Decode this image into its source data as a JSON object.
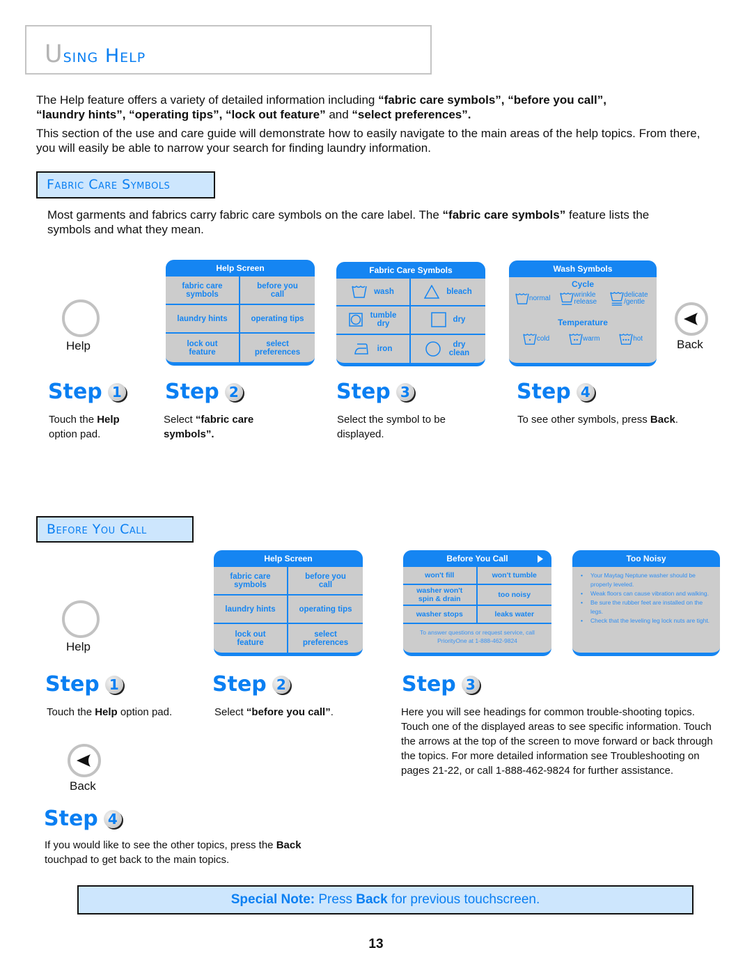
{
  "page": {
    "title_first": "U",
    "title_rest": "sing",
    "title_second": "Help",
    "intro_1_a": "The Help feature offers a variety of detailed information including ",
    "intro_1_b": "“fabric care symbols”, “before you call”,",
    "intro_1_c": "“laundry hints”, “operating tips”, “lock out feature”",
    "intro_1_d": " and ",
    "intro_1_e": "“select preferences”.",
    "intro_2": "This section of the use and care guide will demonstrate how to easily navigate to the main areas of the help topics. From there, you will easily be able to narrow your search for finding laundry information.",
    "page_number": "13"
  },
  "fabric_care": {
    "heading": "Fabric Care Symbols",
    "desc_a": "Most garments and fabrics carry fabric care symbols on the care label. The ",
    "desc_b": "“fabric care symbols”",
    "desc_c": " feature lists the symbols and what they mean.",
    "help_pad_label": "Help",
    "back_pad_label": "Back",
    "help_screen": {
      "title": "Help Screen",
      "items": [
        "fabric care symbols",
        "before you call",
        "laundry hints",
        "operating tips",
        "lock out feature",
        "select preferences"
      ]
    },
    "symbols_screen": {
      "title": "Fabric Care Symbols",
      "items": [
        "wash",
        "bleach",
        "tumble dry",
        "dry",
        "iron",
        "dry clean"
      ]
    },
    "wash_screen": {
      "title": "Wash Symbols",
      "cycle_heading": "Cycle",
      "cycle": [
        "normal",
        "wrinkle release",
        "delicate /gentle"
      ],
      "temp_heading": "Temperature",
      "temps": [
        "cold",
        "warm",
        "hot"
      ]
    },
    "steps": [
      {
        "label": "Step",
        "num": "1",
        "desc_a": "Touch the ",
        "desc_b": "Help",
        "desc_c": " option pad."
      },
      {
        "label": "Step",
        "num": "2",
        "desc_a": "Select ",
        "desc_b": "“fabric care symbols”.",
        "desc_c": ""
      },
      {
        "label": "Step",
        "num": "3",
        "desc_a": "Select the symbol to be displayed.",
        "desc_b": "",
        "desc_c": ""
      },
      {
        "label": "Step",
        "num": "4",
        "desc_a": "To see other symbols, press ",
        "desc_b": "Back",
        "desc_c": "."
      }
    ]
  },
  "before_call": {
    "heading": "Before You Call",
    "help_pad_label": "Help",
    "back_pad_label": "Back",
    "help_screen": {
      "title": "Help Screen",
      "items": [
        "fabric care symbols",
        "before you call",
        "laundry hints",
        "operating tips",
        "lock out feature",
        "select preferences"
      ]
    },
    "byc_screen": {
      "title": "Before You Call",
      "items": [
        "won't fill",
        "won't tumble",
        "washer won't spin & drain",
        "too noisy",
        "washer stops",
        "leaks water"
      ],
      "footer": "To answer questions or request service, call PriorityOne at 1-888-462-9824"
    },
    "noisy_screen": {
      "title": "Too Noisy",
      "bullets": [
        "Your Maytag Neptune washer should be properly leveled.",
        "Weak floors can cause vibration and walking.",
        "Be sure the rubber feet are installed on the legs.",
        "Check that the leveling leg lock nuts are tight."
      ]
    },
    "steps": [
      {
        "label": "Step",
        "num": "1",
        "desc_a": "Touch the ",
        "desc_b": "Help",
        "desc_c": " option pad."
      },
      {
        "label": "Step",
        "num": "2",
        "desc_a": "Select ",
        "desc_b": "“before you call”",
        "desc_c": "."
      },
      {
        "label": "Step",
        "num": "3",
        "desc_a": "Here you will see headings for common trouble-shooting topics. Touch one of the displayed areas to see specific information. Touch the arrows at the top of the screen to move forward or back through the topics.  For more detailed information see Troubleshooting on pages 21-22, or call 1-888-462-9824 for further assistance.",
        "desc_b": "",
        "desc_c": ""
      },
      {
        "label": "Step",
        "num": "4",
        "desc_a": "If you would like to see the other topics, press the ",
        "desc_b": "Back",
        "desc_c": " touchpad to get back to the main topics."
      }
    ]
  },
  "special_note": {
    "label": "Special Note:",
    "text_a": " Press ",
    "text_b": "Back",
    "text_c": " for previous touchscreen."
  },
  "colors": {
    "accent_blue": "#0a7ff2",
    "screen_blue": "#1585f2",
    "screen_gray": "#cccccc",
    "heading_box_bg": "#cde6fd",
    "title_gray": "#b4b4b4"
  }
}
